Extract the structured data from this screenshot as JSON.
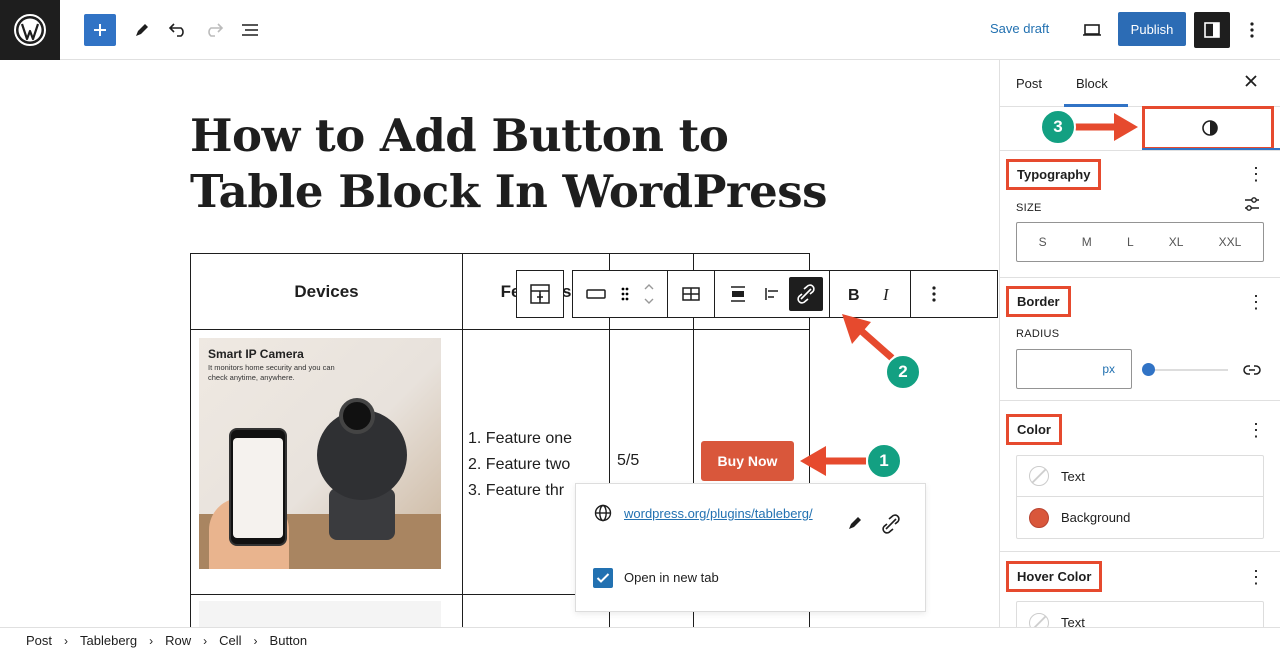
{
  "topbar": {
    "save_draft": "Save draft",
    "publish": "Publish"
  },
  "post": {
    "title": "How to Add Button to Table Block In WordPress"
  },
  "table": {
    "headers": [
      "Devices",
      "Features"
    ],
    "row1": {
      "image_title": "Smart IP Camera",
      "image_sub": "It monitors home security and you can check anytime, anywhere.",
      "features": [
        "1. Feature one",
        "2. Feature two",
        "3. Feature thr"
      ],
      "rating": "5/5",
      "button": "Buy Now"
    }
  },
  "link_popover": {
    "url": "wordpress.org/plugins/tableberg/",
    "open_new_tab": "Open in new tab"
  },
  "annotations": [
    "1",
    "2",
    "3"
  ],
  "sidebar": {
    "tabs": [
      "Post",
      "Block"
    ],
    "typography": {
      "title": "Typography",
      "size_label": "SIZE",
      "sizes": [
        "S",
        "M",
        "L",
        "XL",
        "XXL"
      ]
    },
    "border": {
      "title": "Border",
      "radius_label": "RADIUS",
      "unit": "px"
    },
    "color": {
      "title": "Color",
      "items": [
        "Text",
        "Background"
      ]
    },
    "hover_color": {
      "title": "Hover Color",
      "items": [
        "Text"
      ]
    }
  },
  "breadcrumb": [
    "Post",
    "Tableberg",
    "Row",
    "Cell",
    "Button"
  ],
  "colors": {
    "accent": "#3173c5",
    "button_bg": "#d9573b",
    "highlight": "#e64a2e",
    "badge": "#13a082"
  }
}
